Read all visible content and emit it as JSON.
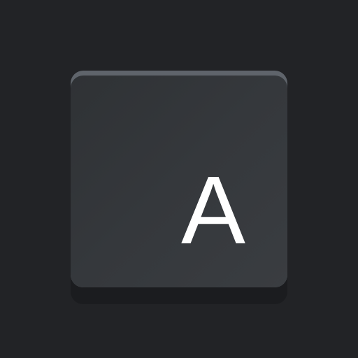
{
  "key": {
    "label": "A",
    "colors": {
      "background": "#222326",
      "cap": "#35383c",
      "rim": "#5f646b",
      "shadow": "#1b1c1f",
      "label": "#ffffff"
    }
  }
}
